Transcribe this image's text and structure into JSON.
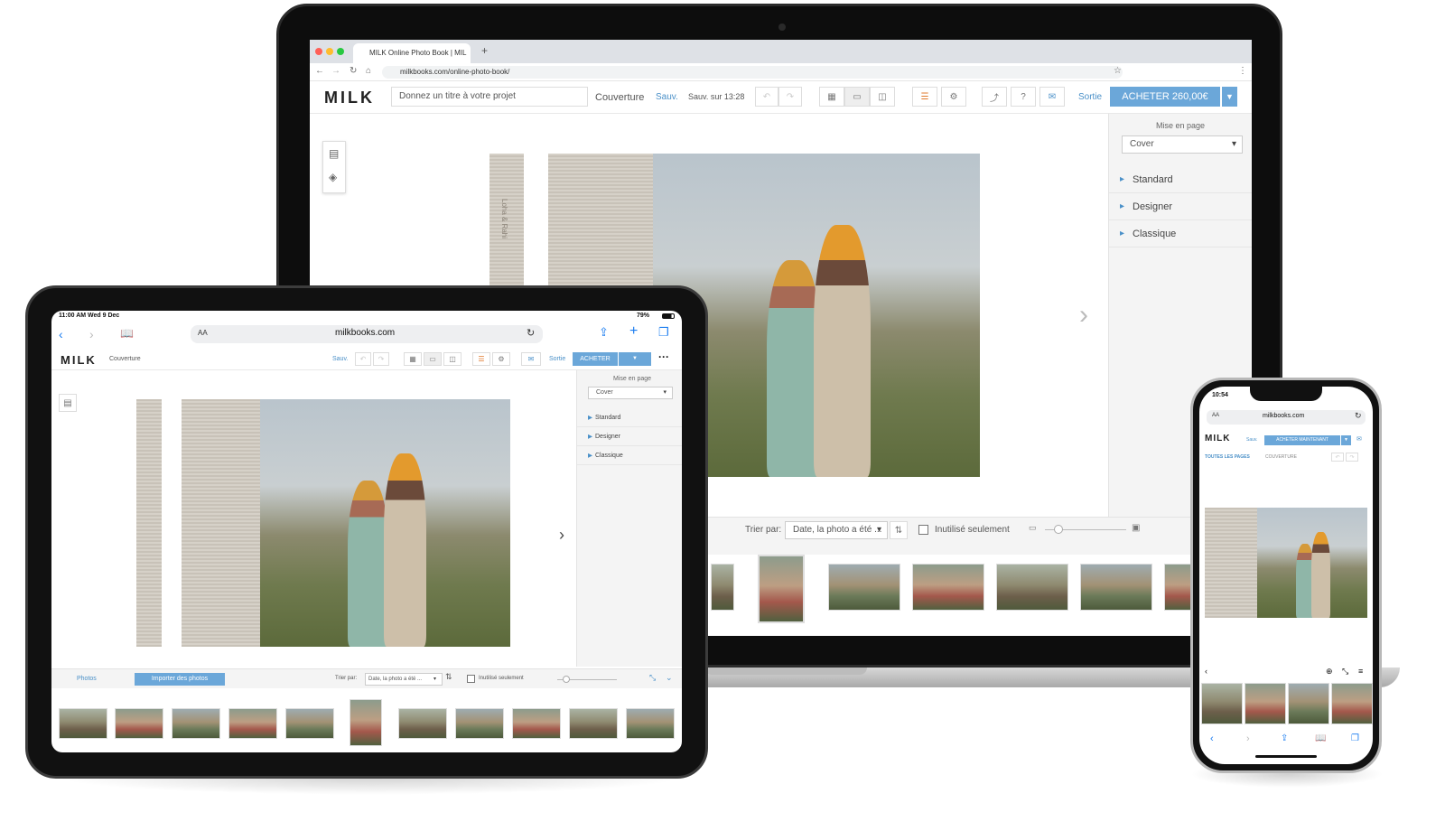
{
  "laptop": {
    "browser": {
      "tab_title": "MILK Online Photo Book | MIL",
      "url": "milkbooks.com/online-photo-book/"
    },
    "app": {
      "logo": "MILK",
      "title_placeholder": "Donnez un titre à votre projet",
      "page_label": "Couverture",
      "save_link": "Sauv.",
      "save_status": "Sauv. sur 13:28",
      "exit_link": "Sortie",
      "buy_button": "ACHETER 260,00€"
    },
    "sidebar": {
      "layout_label": "Mise en page",
      "layout_select": "Cover",
      "items": [
        "Standard",
        "Designer",
        "Classique"
      ]
    },
    "book": {
      "spine_text": "Loha & Rahi"
    },
    "photo_strip": {
      "sort_label": "Trier par:",
      "sort_select": "Date, la photo a été ...",
      "unused_only": "Inutilisé seulement"
    }
  },
  "tablet": {
    "status_time": "11:00 AM  Wed 9 Dec",
    "battery": "79%",
    "url": "milkbooks.com",
    "aa": "AA",
    "app": {
      "logo": "MILK",
      "page_label": "Couverture",
      "save_link": "Sauv.",
      "exit_link": "Sortie",
      "buy_button": "ACHETER"
    },
    "sidebar": {
      "layout_label": "Mise en page",
      "layout_select": "Cover",
      "items": [
        "Standard",
        "Designer",
        "Classique"
      ]
    },
    "bottom": {
      "photos_tab": "Photos",
      "import_button": "Importer des photos",
      "sort_label": "Trier par:",
      "sort_select": "Date, la photo a été ...",
      "unused_only": "Inutilisé seulement"
    }
  },
  "phone": {
    "status_time": "10:54",
    "aa": "AA",
    "url": "milkbooks.com",
    "app": {
      "logo": "MILK",
      "save_link": "Sauv.",
      "buy_button": "ACHETER MAINTENANT",
      "all_pages": "TOUTES LES PAGES",
      "cover": "COUVERTURE"
    }
  },
  "colors": {
    "accent": "#6ba7d9",
    "link": "#4a90c8",
    "bezel": "#111111"
  }
}
